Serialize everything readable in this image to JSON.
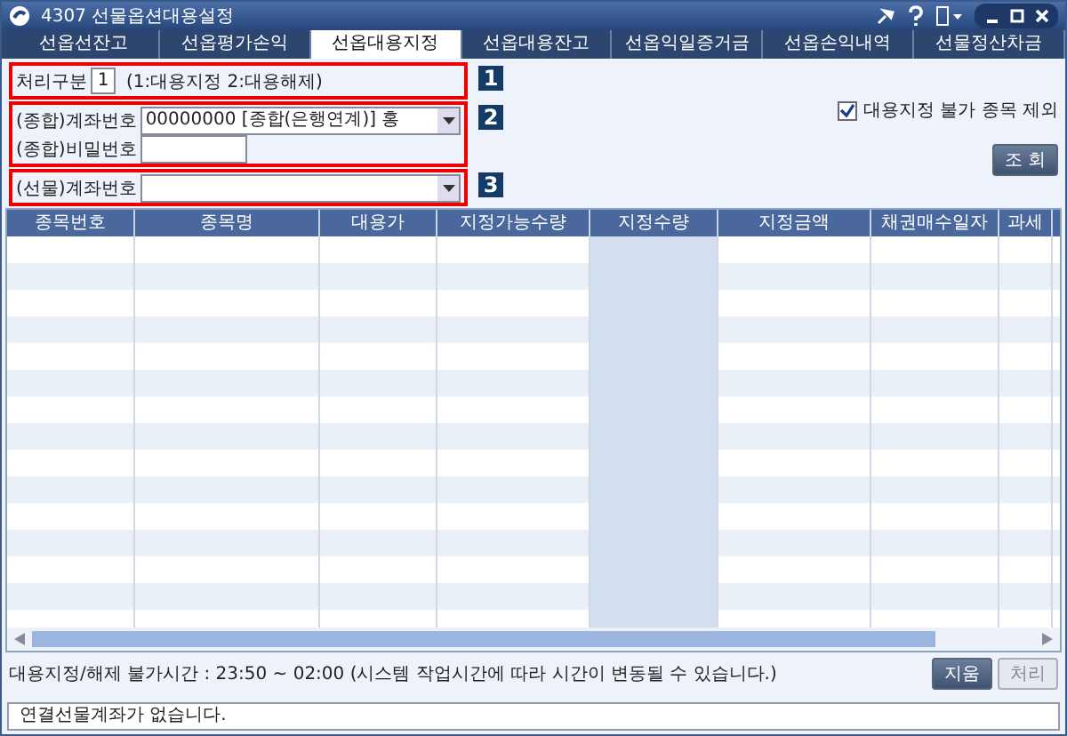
{
  "window": {
    "title": "4307 선물옵션대용설정"
  },
  "tabs": [
    {
      "label": "선옵선잔고",
      "selected": false
    },
    {
      "label": "선옵평가손익",
      "selected": false
    },
    {
      "label": "선옵대용지정",
      "selected": true
    },
    {
      "label": "선옵대용잔고",
      "selected": false
    },
    {
      "label": "선옵익일증거금",
      "selected": false
    },
    {
      "label": "선옵손익내역",
      "selected": false
    },
    {
      "label": "선물정산차금",
      "selected": false
    }
  ],
  "groups": [
    {
      "marker": "1",
      "fields": [
        {
          "kind": "code",
          "label": "처리구분",
          "value": "1",
          "hint": "(1:대용지정 2:대용해제)"
        }
      ]
    },
    {
      "marker": "2",
      "fields": [
        {
          "kind": "select",
          "label": "(종합)계좌번호",
          "value": "00000000 [종합(은행연계)] 홍"
        },
        {
          "kind": "password",
          "label": "(종합)비밀번호"
        }
      ]
    },
    {
      "marker": "3",
      "fields": [
        {
          "kind": "select",
          "label": "(선물)계좌번호"
        }
      ]
    }
  ],
  "exclude_option": {
    "label": "대용지정 불가 종목 제외",
    "checked": true
  },
  "query_button": "조 회",
  "table": {
    "columns": [
      "종목번호",
      "종목명",
      "대용가",
      "지정가능수량",
      "지정수량",
      "지정금액",
      "채권매수일자",
      "과세"
    ]
  },
  "notice": "대용지정/해제 불가시간 : 23:50 ~ 02:00 (시스템 작업시간에 따라 시간이 변동될 수 있습니다.)",
  "actions": [
    {
      "label": "지움",
      "disabled": false
    },
    {
      "label": "처리",
      "disabled": true
    }
  ],
  "status_bar": "연결선물계좌가 없습니다."
}
